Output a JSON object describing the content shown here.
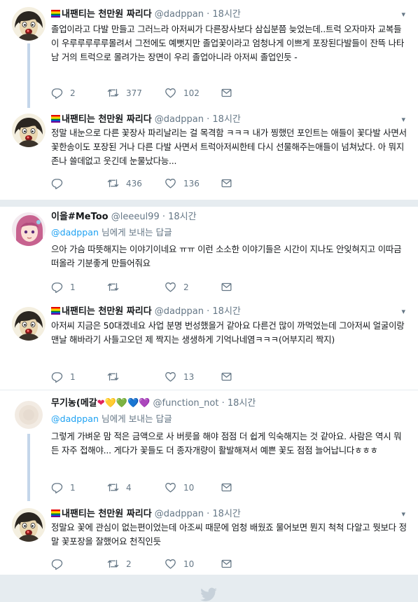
{
  "tweets": [
    {
      "name": "내팬티는 천만원 짜리다",
      "handle": "@dadppan",
      "time": "18시간",
      "text": "졸업이라고 다발 만들고 그러느라 아저씨가 다른장사보다 삼십분쯤 늦었는데..트럭 오자마자 교복들이 우루루루루루몰려서 그전에도 예뻣지만 졸업꽃이라고 엄청나게 이쁘게 포장된다발들이 잔뜩 나타남 거의 트럭으로 몰려가는 장면이 우리 졸업아니라 아저씨 졸업인듯 -",
      "replies": "2",
      "retweets": "377",
      "likes": "102"
    },
    {
      "name": "내팬티는 천만원 짜리다",
      "handle": "@dadppan",
      "time": "18시간",
      "text": "정말 내눈으로 다른 꽃장사 파리날리는 걸 목격함 ㅋㅋㅋ 내가 찡했던 포인트는 애들이 꽃다발 사면서 꽃한송이도 포장된 거나 다른 다발 사면서 트럭아저씨한테 다시 선물해주는애들이 넘쳐났다. 아 뭐지 존나 쓸데없고 웃긴데 눈물났다능...",
      "replies": "",
      "retweets": "436",
      "likes": "136"
    },
    {
      "name": "이을#MeToo",
      "handle": "@leeeul99",
      "time": "18시간",
      "replying_to": "@dadppan",
      "replying_suffix": " 님에게 보내는 답글",
      "text": "으아 가슴 따뜻해지는 이야기이네요 ㅠㅠ 이런 소소한 이야기들은 시간이 지나도 안잊혀지고 이따금 떠올라 기분좋게 만들어줘요",
      "replies": "1",
      "retweets": "",
      "likes": "2"
    },
    {
      "name": "내팬티는 천만원 짜리다",
      "handle": "@dadppan",
      "time": "18시간",
      "text": "아저씨 지금은 50대겠네요 사업 분명 번성했을거 같아요 다른건 많이 까먹었는데 그아저씨 얼굴이랑 맨날 해바라기 사들고오던 제 짝지는 생생하게 기억나네염ㅋㅋㅋ(어부지리 짝지)",
      "replies": "1",
      "retweets": "",
      "likes": "13"
    },
    {
      "name": "무기농(메갈",
      "hearts": "❤💛💚💙💜",
      "handle": "@function_not",
      "time": "18시간",
      "replying_to": "@dadppan",
      "replying_suffix": " 님에게 보내는 답글",
      "text": "그렇게 가벼운 맘 적은 금액으로 사 버릇을 해야 점점 더 쉽게 익숙해지는 것 같아요. 사람은 역시 뭐든 자주 접해야... 게다가 꽃들도 더 종자개량이 활발해져서 예쁜 꽃도 점점 늘어납니다ㅎㅎㅎ",
      "replies": "1",
      "retweets": "4",
      "likes": "10"
    },
    {
      "name": "내팬티는 천만원 짜리다",
      "handle": "@dadppan",
      "time": "18시간",
      "text": "정말요 꽃에 관심이 없는편이었는데 아조씨 때문에 엄청 배웠죠 물어보면 뭔지 척척 다알고 뭣보다 정말 꽃포장을 잘했어요 천직인듯",
      "replies": "",
      "retweets": "2",
      "likes": "10"
    }
  ],
  "dot": "·"
}
